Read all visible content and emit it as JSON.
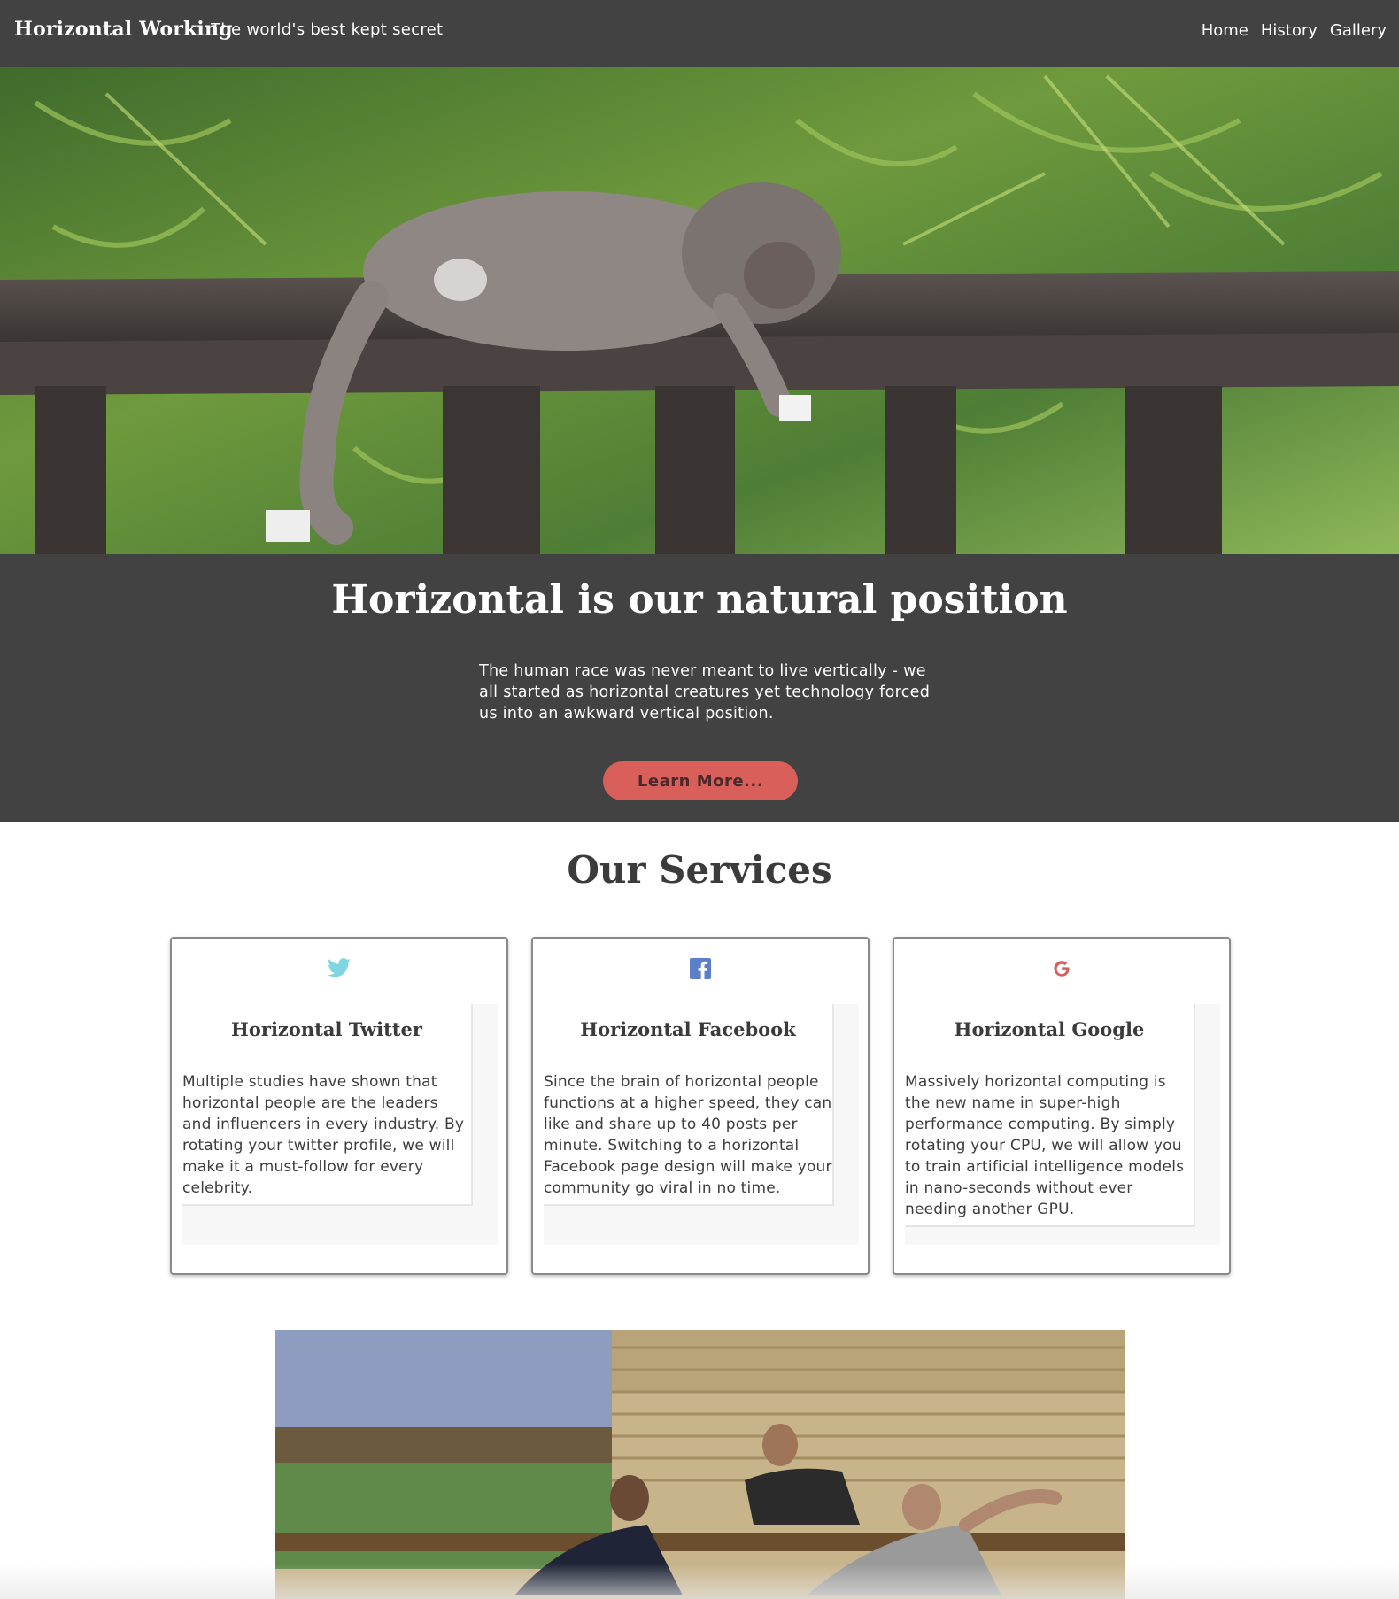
{
  "header": {
    "brand": "Horizontal Working",
    "tagline": "The world's best kept secret",
    "nav": [
      "Home",
      "History",
      "Gallery"
    ]
  },
  "hero": {
    "image": "monkey-lying-on-railing-photo",
    "title": "Horizontal is our natural position",
    "text": "The human race was never meant to live vertically - we all started as horizontal creatures yet technology forced us into an awkward vertical position.",
    "button": "Learn More..."
  },
  "services": {
    "title": "Our Services",
    "cards": [
      {
        "icon": "twitter-icon",
        "icon_color": "#7fd6e0",
        "title": "Horizontal Twitter",
        "text": "Multiple studies have shown that horizontal people are the leaders and influencers in every industry. By rotating your twitter profile, we will make it a must-follow for every celebrity."
      },
      {
        "icon": "facebook-icon",
        "icon_color": "#5b7fc9",
        "title": "Horizontal Facebook",
        "text": "Since the brain of horizontal people functions at a higher speed, they can like and share up to 40 posts per minute. Switching to a horizontal Facebook page design will make your community go viral in no time."
      },
      {
        "icon": "google-icon",
        "icon_color": "#d0625e",
        "title": "Horizontal Google",
        "text": "Massively horizontal computing is the new name in super-high performance computing. By simply rotating your CPU, we will allow you to train artificial intelligence models in nano-seconds without ever needing another GPU."
      }
    ]
  },
  "gallery": {
    "image": "people-lounging-on-bench-photo"
  },
  "colors": {
    "header_bg": "#424242",
    "accent": "#d9605a"
  }
}
